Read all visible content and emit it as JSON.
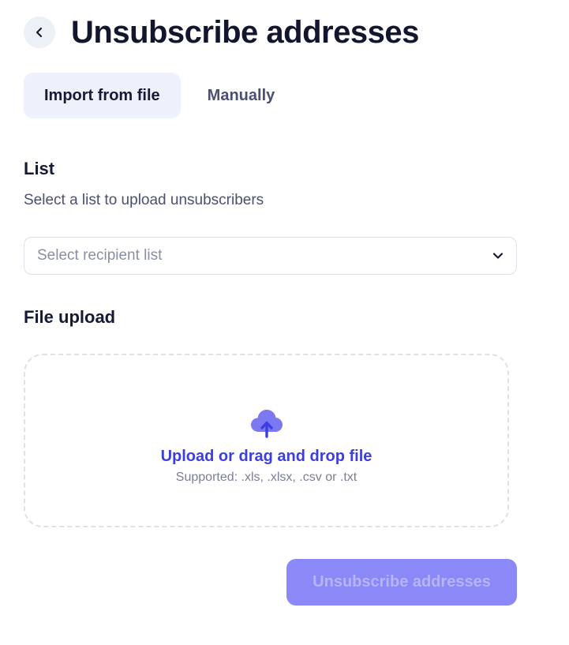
{
  "header": {
    "back_icon": "chevron-left-icon",
    "title": "Unsubscribe addresses"
  },
  "tabs": [
    {
      "label": "Import from file",
      "active": true
    },
    {
      "label": "Manually",
      "active": false
    }
  ],
  "list_section": {
    "title": "List",
    "subtitle": "Select a list to upload unsubscribers",
    "select": {
      "placeholder": "Select recipient list",
      "value": "",
      "icon": "chevron-down-icon"
    }
  },
  "file_section": {
    "title": "File upload",
    "dropzone": {
      "icon": "cloud-upload-icon",
      "action_label": "Upload or drag and drop file",
      "hint": "Supported: .xls, .xlsx, .csv or .txt"
    }
  },
  "footer": {
    "submit_label": "Unsubscribe addresses",
    "submit_disabled": true
  },
  "colors": {
    "accent": "#3c3ee0",
    "icon_fill": "#7b78f2",
    "button_disabled_bg": "#8b88f8",
    "active_tab_bg": "#eef0fb"
  }
}
